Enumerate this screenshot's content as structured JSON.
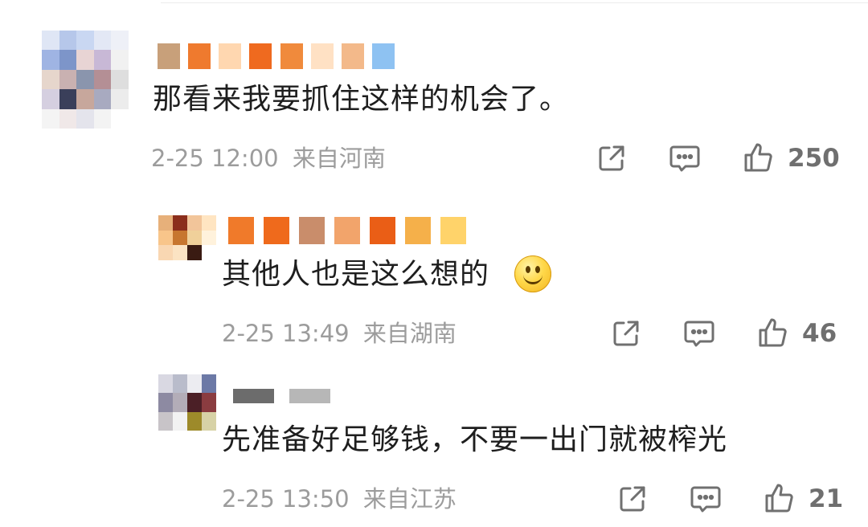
{
  "comments": [
    {
      "text": "那看来我要抓住这样的机会了。",
      "date": "2-25 12:00",
      "location": "来自河南",
      "likes": "250",
      "avatar_colors": [
        "#dfe6f5",
        "#b6c7ea",
        "#c9d7f2",
        "#e3e8f5",
        "#eef0f7",
        "#9fb4e3",
        "#7d95c9",
        "#e8d4d4",
        "#c8b8d6",
        "#f1f1f1",
        "#e6d6cc",
        "#c9b1b1",
        "#8a95ad",
        "#b48f95",
        "#dedede",
        "#d5cfe0",
        "#3a3f5a",
        "#c7a79c",
        "#a8aac0",
        "#ececec",
        "#f4f4f4",
        "#f0e8e8",
        "#e4e4ec",
        "#f3f3f3",
        "#ffffff"
      ],
      "name_colors": [
        "#c8a07a",
        "#ef7a2e",
        "#ffd7b0",
        "#ef6a1f",
        "#f08a3c",
        "#ffe1c4",
        "#f3b98a",
        "#8ec2f2"
      ],
      "icons": {
        "share": "share-icon",
        "comment": "comment-icon",
        "like": "thumbs-up-icon"
      }
    },
    {
      "text": "其他人也是这么想的",
      "emoji": "smile-emoji",
      "date": "2-25 13:49",
      "location": "来自湖南",
      "likes": "46",
      "avatar_colors": [
        "#e7b07a",
        "#8b2e1c",
        "#f2c59a",
        "#ffe5c2",
        "#f8c58a",
        "#c7762f",
        "#f0d09a",
        "#fff2dc",
        "#f9d7b2",
        "#fbe3c3",
        "#3a1b12",
        "#ffffff"
      ],
      "name_colors": [
        "#f07a2a",
        "#ef6a1c",
        "#c98d6b",
        "#f2a46b",
        "#ea5e16",
        "#f5b04a",
        "#ffd36a"
      ]
    },
    {
      "text": "先准备好足够钱，不要一出门就被榨光",
      "date": "2-25 13:50",
      "location": "来自江苏",
      "likes": "21",
      "avatar_colors": [
        "#d9d8e2",
        "#b9bccb",
        "#ececf1",
        "#6c79a6",
        "#8d8aa2",
        "#b3adb8",
        "#4b1f26",
        "#8a3c40",
        "#c8c4c8",
        "#f2f2f2",
        "#9d8a2a",
        "#d7d2a6"
      ],
      "name_colors": [
        "#6c6c6c",
        "#b7b7b7"
      ]
    }
  ]
}
